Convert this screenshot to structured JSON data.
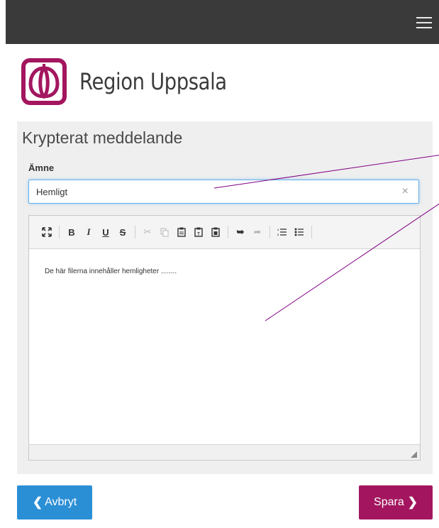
{
  "header": {
    "menu_icon": "hamburger-icon",
    "background": "#3a3a3a"
  },
  "brand": {
    "name": "Region Uppsala",
    "logo_icon": "region-uppsala-logo",
    "logo_color": "#a3165f"
  },
  "form": {
    "title": "Krypterat meddelande",
    "subject_label": "Ämne",
    "subject_value": "Hemligt",
    "clear_symbol": "×"
  },
  "editor": {
    "toolbar": [
      {
        "name": "maximize-icon",
        "glyph": "⛶",
        "enabled": true
      },
      {
        "name": "bold-button",
        "glyph": "B",
        "enabled": true
      },
      {
        "name": "italic-button",
        "glyph": "I",
        "enabled": true
      },
      {
        "name": "underline-button",
        "glyph": "U",
        "enabled": true
      },
      {
        "name": "strikethrough-button",
        "glyph": "S",
        "enabled": true
      },
      {
        "name": "cut-icon",
        "glyph": "✂",
        "enabled": false
      },
      {
        "name": "copy-icon",
        "glyph": "⎘",
        "enabled": false
      },
      {
        "name": "paste-icon",
        "glyph": "📋",
        "enabled": true
      },
      {
        "name": "paste-text-icon",
        "glyph": "📋",
        "enabled": true
      },
      {
        "name": "paste-word-icon",
        "glyph": "📋",
        "enabled": true
      },
      {
        "name": "undo-icon",
        "glyph": "↶",
        "enabled": true
      },
      {
        "name": "redo-icon",
        "glyph": "↷",
        "enabled": false
      },
      {
        "name": "numbered-list-icon",
        "glyph": "≔",
        "enabled": true
      },
      {
        "name": "bulleted-list-icon",
        "glyph": "☰",
        "enabled": true
      }
    ],
    "body_text": "De här filerna innehåller hemligheter ........"
  },
  "actions": {
    "cancel_label": "Avbryt",
    "cancel_color": "#2b8fd6",
    "save_label": "Spara",
    "save_color": "#a3165f"
  },
  "annotation_color": "#800080"
}
